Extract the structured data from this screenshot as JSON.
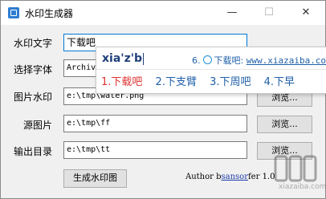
{
  "window": {
    "title": "水印生成器",
    "controls": {
      "minimize": "—",
      "maximize": "☐",
      "close": "✕"
    }
  },
  "form": {
    "watermark_text": {
      "label": "水印文字",
      "value": "下载吧"
    },
    "font": {
      "label": "选择字体",
      "value": "Archiv"
    },
    "image_watermark": {
      "label": "图片水印",
      "value": "e:\\tmp\\water.png",
      "browse": "浏览..."
    },
    "source_image": {
      "label": "源图片",
      "value": "e:\\tmp\\ff",
      "browse": "浏览..."
    },
    "output_dir": {
      "label": "输出目录",
      "value": "e:\\tmp\\tt",
      "browse": "浏览..."
    },
    "generate_button": "生成水印图"
  },
  "ime": {
    "composition": "xia'z'b",
    "hint_index": "6.",
    "hint_text": "下载吧:",
    "hint_url": "www.xiazaiba.com",
    "candidates": [
      "1.下载吧",
      "2.下支臂",
      "3.下周吧",
      "4.下早"
    ]
  },
  "footer": {
    "author_prefix": "Author b",
    "author_link": "sansor",
    "author_suffix": "fer 1.0"
  },
  "watermark_overlay": {
    "text": "xiazaiba.com"
  },
  "colors": {
    "accent": "#0078d7",
    "ime_text": "#1f5fa8",
    "ime_selected": "#e03030"
  }
}
